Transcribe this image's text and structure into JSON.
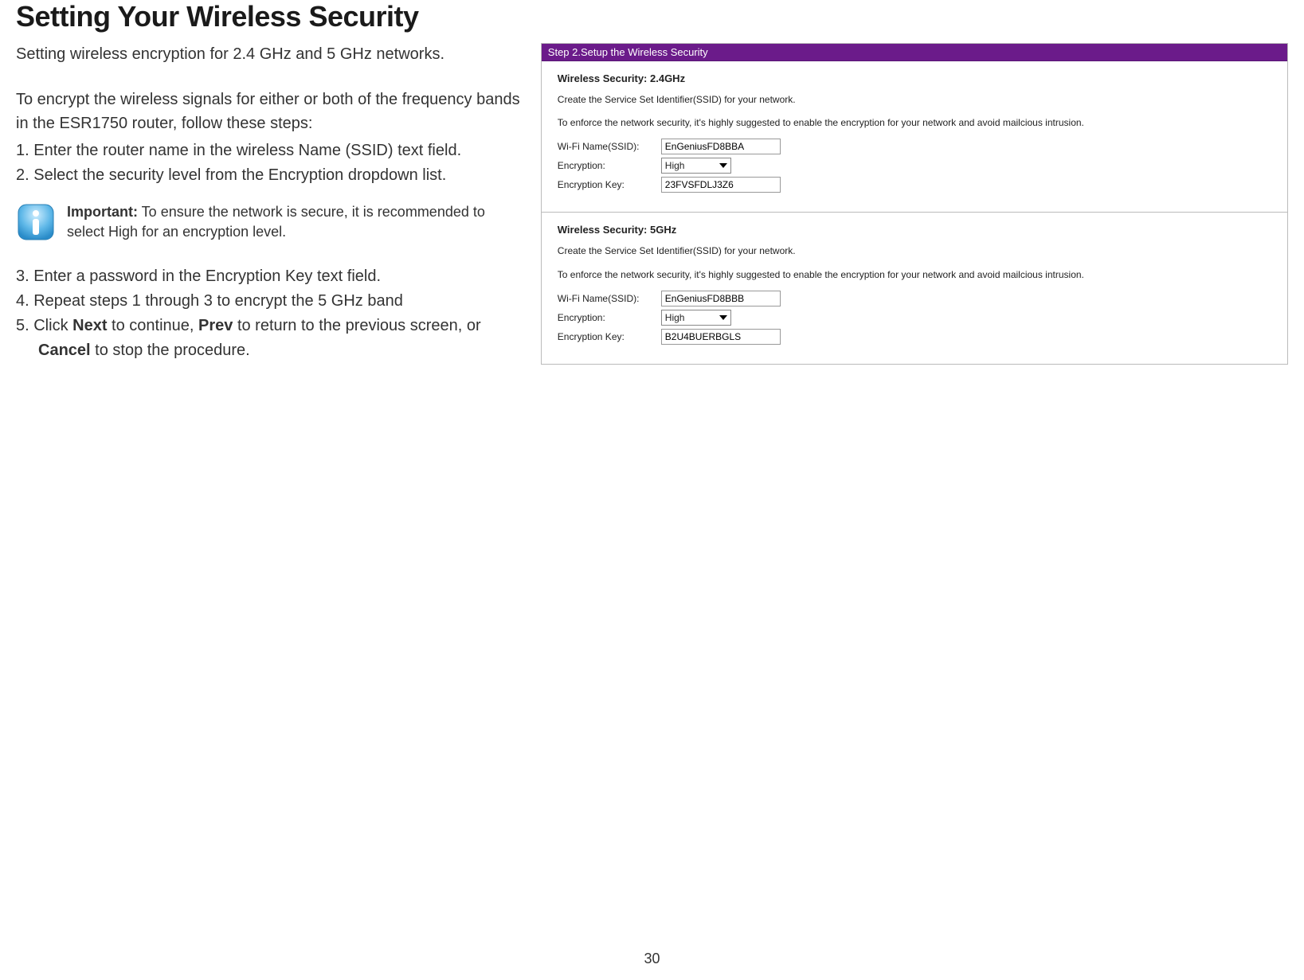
{
  "title": "Setting Your Wireless Security",
  "subtitle": "Setting wireless encryption for 2.4 GHz and 5 GHz networks.",
  "intro": "To encrypt the wireless signals for either or both of the frequency bands in the ESR1750 router, follow these steps:",
  "steps": {
    "s1": "1. Enter the router name in the wireless Name (SSID) text field.",
    "s2": "2. Select the security level from the Encryption dropdown list.",
    "s3": "3. Enter a password in the Encryption Key text field.",
    "s4": "4. Repeat steps 1 through 3 to encrypt the 5 GHz band",
    "s5_pre": "5. Click ",
    "s5_next": "Next",
    "s5_mid1": " to continue, ",
    "s5_prev": "Prev",
    "s5_mid2": " to return to the previous screen, or ",
    "s5_cancel": "Cancel",
    "s5_end": " to stop the procedure."
  },
  "important": {
    "label": "Important:",
    "text": " To ensure the network is secure, it is recommended to select High for an encryption level."
  },
  "panel": {
    "banner": "Step 2.Setup the Wireless Security",
    "band24": {
      "title": "Wireless Security: 2.4GHz",
      "desc1": "Create the Service Set Identifier(SSID) for your network.",
      "desc2": "To enforce the network security, it's highly suggested to enable the encryption for your network and avoid mailcious intrusion.",
      "ssid_label": "Wi-Fi Name(SSID):",
      "ssid_value": "EnGeniusFD8BBA",
      "enc_label": "Encryption:",
      "enc_value": "High",
      "key_label": "Encryption Key:",
      "key_value": "23FVSFDLJ3Z6"
    },
    "band5": {
      "title": "Wireless Security: 5GHz",
      "desc1": "Create the Service Set Identifier(SSID) for your network.",
      "desc2": "To enforce the network security, it's highly suggested to enable the encryption for your network and avoid mailcious intrusion.",
      "ssid_label": "Wi-Fi Name(SSID):",
      "ssid_value": "EnGeniusFD8BBB",
      "enc_label": "Encryption:",
      "enc_value": "High",
      "key_label": "Encryption Key:",
      "key_value": "B2U4BUERBGLS"
    }
  },
  "page_number": "30"
}
